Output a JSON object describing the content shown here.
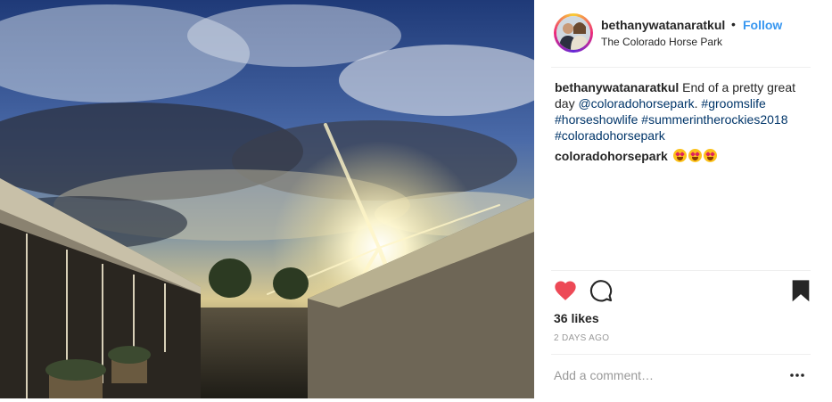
{
  "post": {
    "author": "bethanywatanaratkul",
    "separator": "•",
    "follow_label": "Follow",
    "location": "The Colorado Horse Park",
    "caption": {
      "username": "bethanywatanaratkul",
      "text_1": " End of a pretty great day ",
      "mention": "@coloradohorsepark",
      "text_2": ". ",
      "tags": [
        "#groomslife",
        "#horseshowlife",
        "#summerintherockies2018",
        "#coloradohorsepark"
      ]
    },
    "comments": [
      {
        "username": "coloradohorsepark",
        "emoji": [
          "smiling-face-with-heart-eyes",
          "smiling-face-with-heart-eyes",
          "smiling-face-with-heart-eyes"
        ]
      }
    ],
    "likes_label": "36 likes",
    "date_label": "2 DAYS AGO",
    "comment_placeholder": "Add a comment…",
    "liked": true,
    "icons": {
      "like": "heart-icon",
      "comment": "comment-bubble-icon",
      "save": "bookmark-icon",
      "more": "more-options-icon"
    },
    "colors": {
      "follow": "#3897f0",
      "heart": "#ed4956",
      "text": "#262626",
      "muted": "#999999",
      "link": "#003569"
    }
  }
}
